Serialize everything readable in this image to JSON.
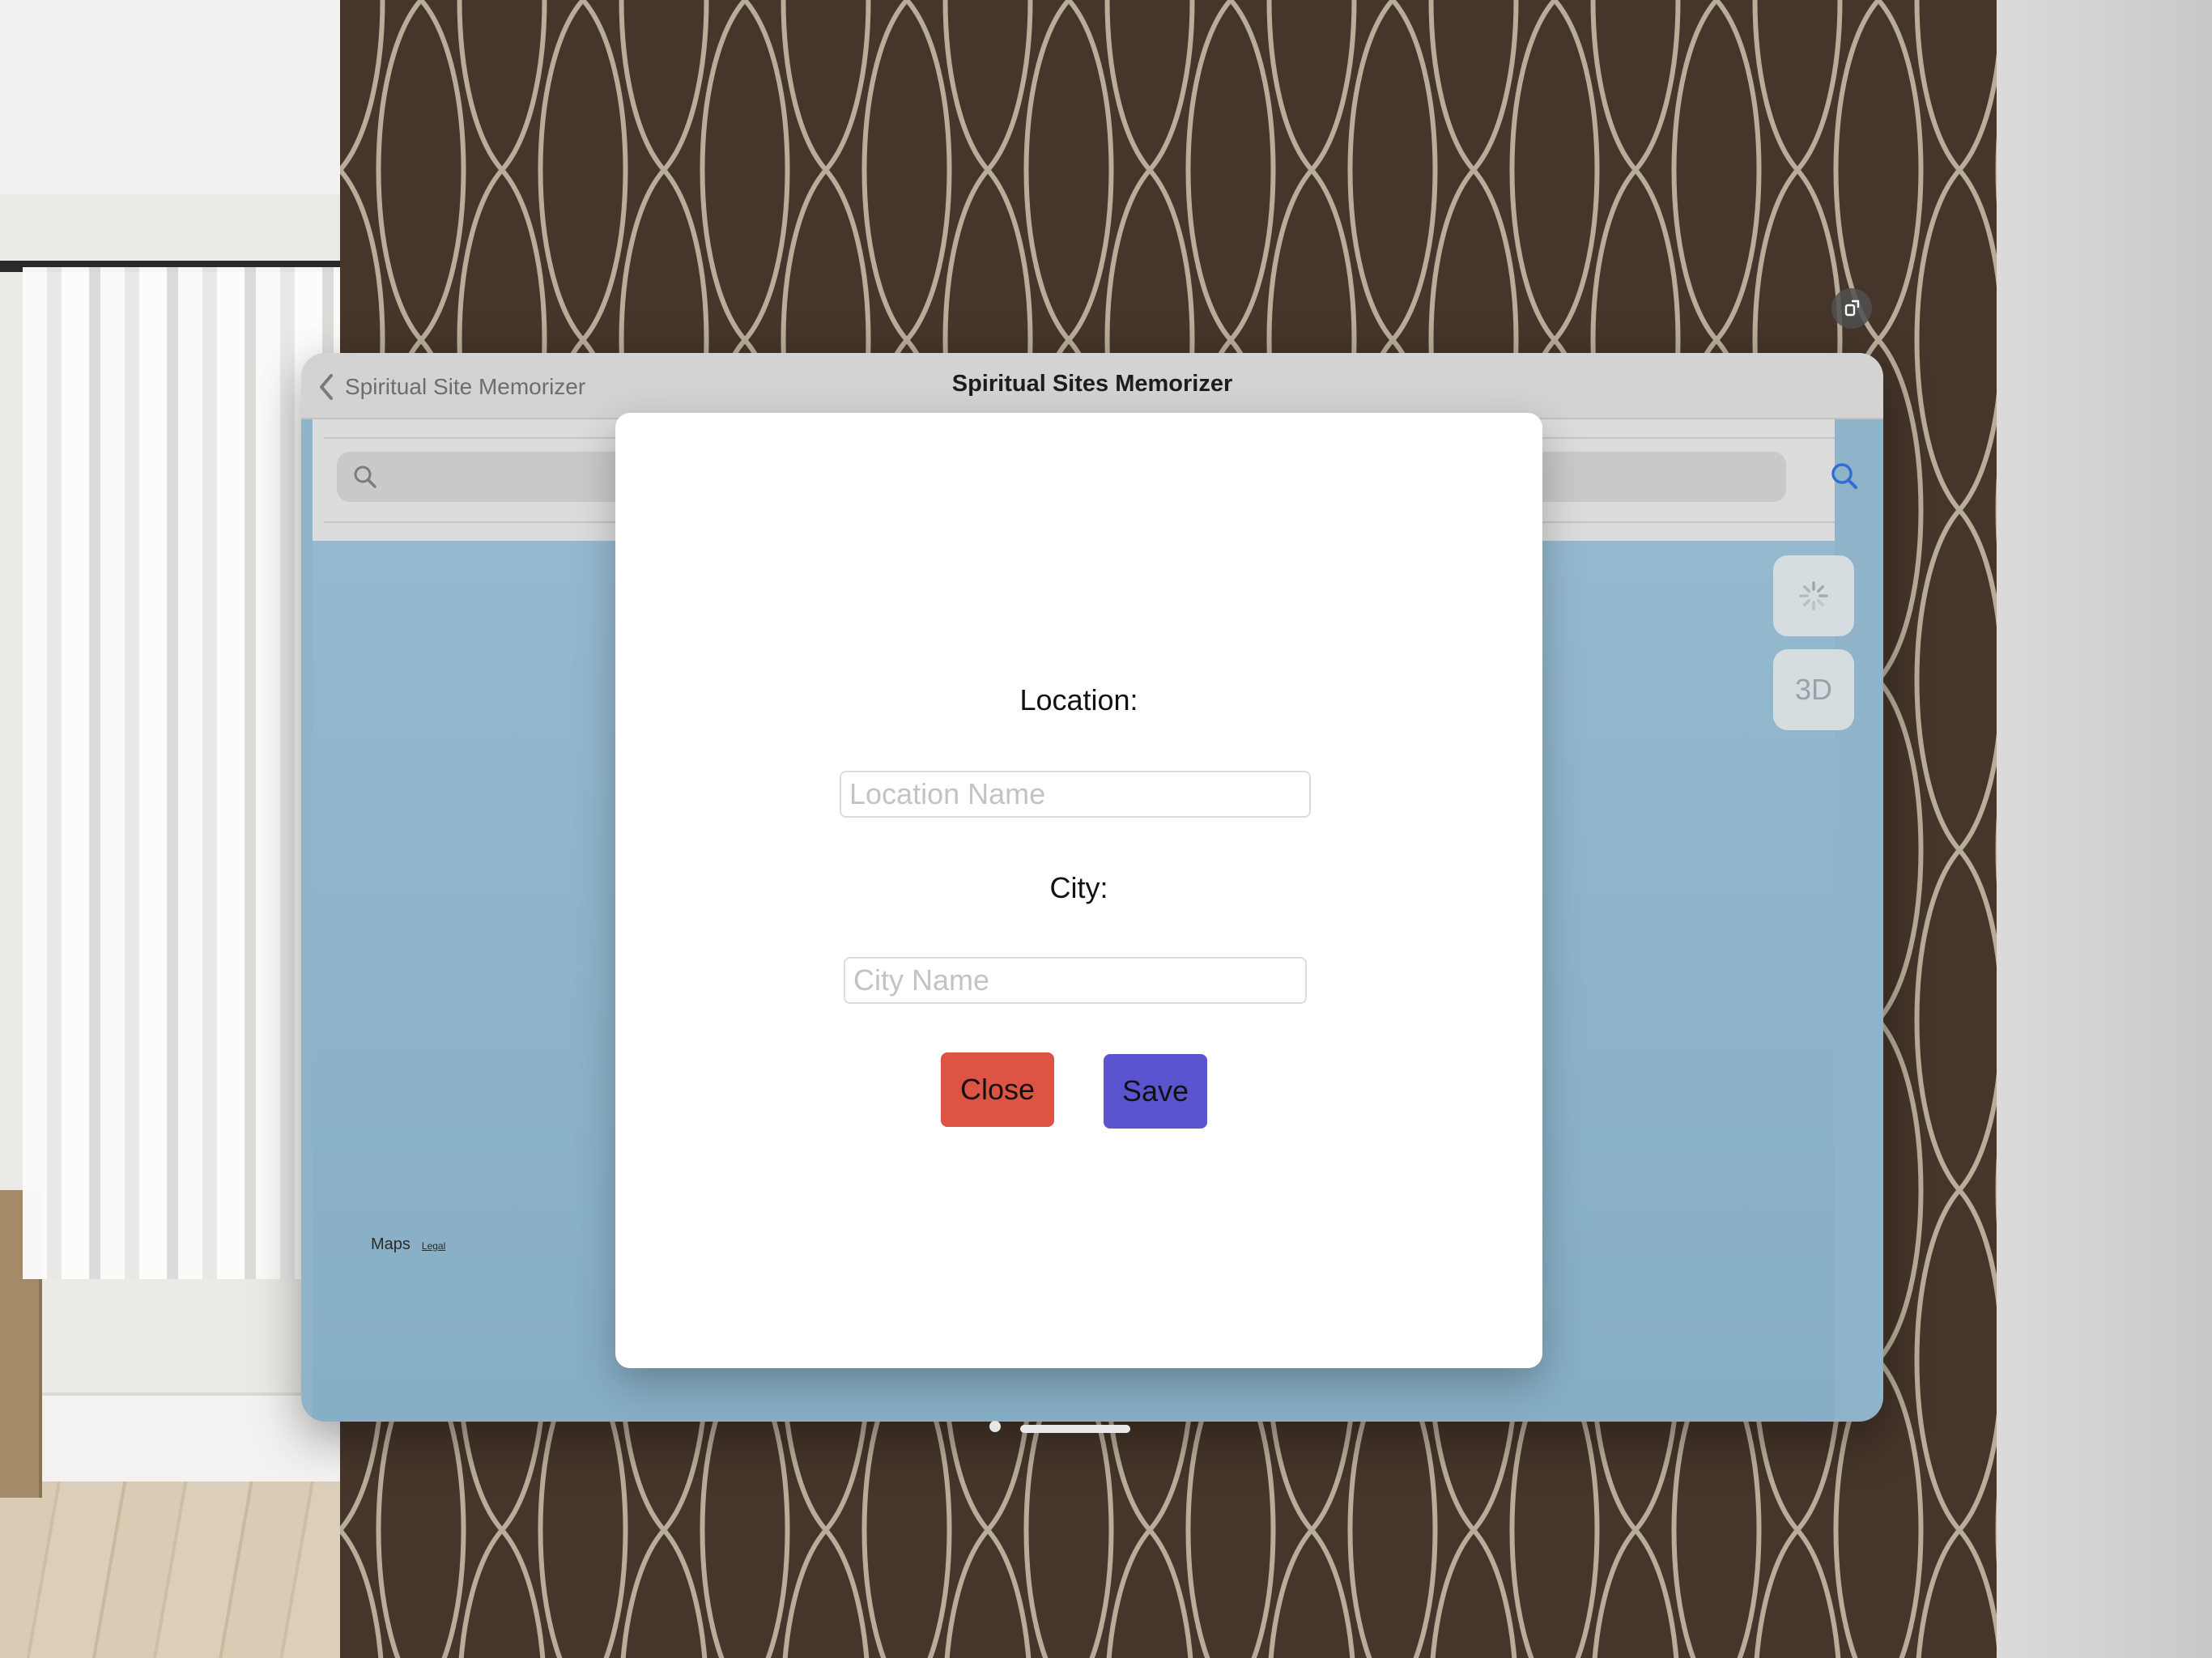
{
  "window": {
    "back_label": "Spiritual Site Memorizer",
    "title": "Spiritual Sites Memorizer"
  },
  "map": {
    "control_3d_label": "3D",
    "attribution": "Maps",
    "legal": "Legal"
  },
  "modal": {
    "location_label": "Location:",
    "location_placeholder": "Location Name",
    "location_value": "",
    "city_label": "City:",
    "city_placeholder": "City Name",
    "city_value": "",
    "close_label": "Close",
    "save_label": "Save"
  },
  "colors": {
    "close_button": "#dd5444",
    "save_button": "#5a55cf",
    "map_water": "#8fb3c8"
  },
  "icons": {
    "back": "chevron-left-icon",
    "search_field": "magnifier-icon",
    "search_button": "search-icon",
    "loading": "spinner-icon",
    "window_resize": "resize-icon"
  }
}
